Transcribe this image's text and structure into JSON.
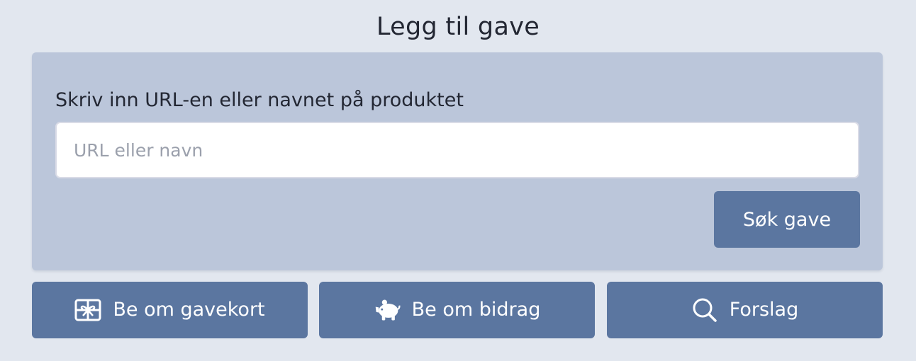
{
  "header": {
    "title": "Legg til gave"
  },
  "form": {
    "label": "Skriv inn URL-en eller navnet på produktet",
    "input_value": "",
    "input_placeholder": "URL eller navn",
    "submit_label": "Søk gave"
  },
  "actions": [
    {
      "label": "Be om gavekort",
      "icon": "gift-card-icon"
    },
    {
      "label": "Be om bidrag",
      "icon": "piggy-bank-icon"
    },
    {
      "label": "Forslag",
      "icon": "search-icon"
    }
  ],
  "colors": {
    "page_background": "#e2e7ef",
    "card_background": "#bbc6da",
    "button_background": "#5b76a0",
    "button_text": "#ffffff"
  }
}
